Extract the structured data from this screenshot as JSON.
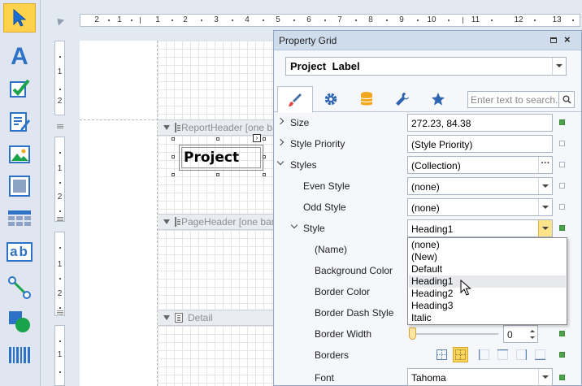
{
  "toolbox": {
    "items": [
      {
        "id": "pointer",
        "icon": "pointer-arrow-icon",
        "selected": true
      },
      {
        "id": "label",
        "icon": "label-a-icon",
        "glyph": "A"
      },
      {
        "id": "checkbox",
        "icon": "checkbox-icon"
      },
      {
        "id": "rich-text",
        "icon": "rich-text-icon"
      },
      {
        "id": "picture-box",
        "icon": "picture-icon"
      },
      {
        "id": "panel",
        "icon": "panel-icon"
      },
      {
        "id": "table",
        "icon": "table-icon"
      },
      {
        "id": "character-comb",
        "icon": "character-comb-icon",
        "glyph": "ab"
      },
      {
        "id": "line",
        "icon": "line-icon"
      },
      {
        "id": "shape",
        "icon": "shape-icon"
      },
      {
        "id": "barcode",
        "icon": "barcode-icon"
      }
    ]
  },
  "ruler": {
    "labels": [
      "2",
      "1",
      "1",
      "2",
      "3",
      "4",
      "5",
      "6",
      "7",
      "8",
      "9",
      "10",
      "11",
      "12",
      "13"
    ],
    "vertical_labels": [
      "1",
      "2",
      "1",
      "2",
      "1",
      "2",
      "1"
    ]
  },
  "bands": [
    {
      "name": "ReportHeader",
      "label": "ReportHeader [one band per report]"
    },
    {
      "name": "PageHeader",
      "label": "PageHeader [one band per page]"
    },
    {
      "name": "Detail",
      "label": "Detail"
    }
  ],
  "report_label": {
    "text": "Project"
  },
  "property_grid": {
    "title": "Property Grid",
    "selected_object": "Project Label",
    "tabs": [
      {
        "id": "appearance",
        "icon": "brush-icon",
        "active": true
      },
      {
        "id": "behavior",
        "icon": "gear-icon",
        "active": false
      },
      {
        "id": "data",
        "icon": "database-icon",
        "active": false
      },
      {
        "id": "tasks",
        "icon": "wrench-icon",
        "active": false
      },
      {
        "id": "favorites",
        "icon": "star-icon",
        "active": false
      }
    ],
    "search_placeholder": "Enter text to search...",
    "rows": [
      {
        "name": "Size",
        "value": "272.23, 84.38",
        "expander": "collapsed",
        "modified": true
      },
      {
        "name": "Style Priority",
        "value": "(Style Priority)",
        "expander": "collapsed",
        "modified": false
      },
      {
        "name": "Styles",
        "value": "(Collection)",
        "expander": "expanded",
        "button": "ellipsis",
        "modified": false
      },
      {
        "name": "Even Style",
        "value": "(none)",
        "button": "dropdown",
        "modified": false
      },
      {
        "name": "Odd Style",
        "value": "(none)",
        "button": "dropdown",
        "modified": false
      },
      {
        "name": "Style",
        "value": "Heading1",
        "expander": "expanded",
        "button": "dropdown",
        "modified": true
      },
      {
        "name": "(Name)"
      },
      {
        "name": "Background Color",
        "modified": true
      },
      {
        "name": "Border Color",
        "modified": true
      },
      {
        "name": "Border Dash Style",
        "modified": true
      },
      {
        "name": "Border Width",
        "value": "0",
        "modified": true
      },
      {
        "name": "Borders",
        "modified": true
      },
      {
        "name": "Font",
        "value": "Tahoma",
        "button": "dropdown",
        "modified": true
      }
    ],
    "style_dropdown": {
      "options": [
        "(none)",
        "(New)",
        "Default",
        "Heading1",
        "Heading2",
        "Heading3",
        "Italic"
      ],
      "hovered": "Heading1"
    },
    "colors": {
      "accent": "#ffd24d",
      "modified_marker": "#4ea24e",
      "title_bar": "#cfdcec"
    }
  }
}
